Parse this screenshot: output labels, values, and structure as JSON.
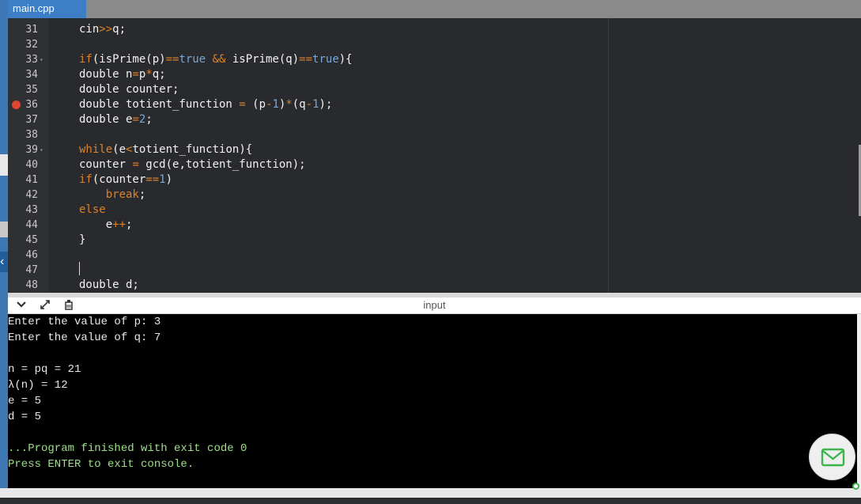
{
  "tab": {
    "filename": "main.cpp"
  },
  "editor": {
    "lines": [
      {
        "num": "31",
        "html": "cin<span class=\"op\">&gt;&gt;</span>q;"
      },
      {
        "num": "32",
        "html": ""
      },
      {
        "num": "33",
        "fold": true,
        "html": "<span class=\"kw\">if</span>(isPrime(p)<span class=\"op\">==</span><span class=\"bool\">true</span> <span class=\"op\">&amp;&amp;</span> isPrime(q)<span class=\"op\">==</span><span class=\"bool\">true</span>){"
      },
      {
        "num": "34",
        "html": "double n<span class=\"op\">=</span>p<span class=\"op\">*</span>q;"
      },
      {
        "num": "35",
        "html": "double counter;"
      },
      {
        "num": "36",
        "breakpoint": true,
        "html": "double totient_function <span class=\"op\">=</span> (p<span class=\"op\">-</span><span class=\"num\">1</span>)<span class=\"op\">*</span>(q<span class=\"op\">-</span><span class=\"num\">1</span>);"
      },
      {
        "num": "37",
        "html": "double e<span class=\"op\">=</span><span class=\"num\">2</span>;"
      },
      {
        "num": "38",
        "html": ""
      },
      {
        "num": "39",
        "fold": true,
        "html": "<span class=\"kw\">while</span>(e<span class=\"op\">&lt;</span>totient_function){"
      },
      {
        "num": "40",
        "html": "counter <span class=\"op\">=</span> gcd(e,totient_function);"
      },
      {
        "num": "41",
        "html": "<span class=\"kw\">if</span>(counter<span class=\"op\">==</span><span class=\"num\">1</span>)"
      },
      {
        "num": "42",
        "html": "    <span class=\"kw\">break</span>;"
      },
      {
        "num": "43",
        "html": "<span class=\"kw\">else</span>"
      },
      {
        "num": "44",
        "html": "    e<span class=\"op\">++</span>;"
      },
      {
        "num": "45",
        "html": "}"
      },
      {
        "num": "46",
        "html": ""
      },
      {
        "num": "47",
        "html": ""
      },
      {
        "num": "48",
        "html": "double d;"
      }
    ]
  },
  "panel": {
    "title": "input"
  },
  "console": {
    "lines": [
      {
        "text": "Enter the value of p: 3",
        "green": false
      },
      {
        "text": "Enter the value of q: 7",
        "green": false
      },
      {
        "text": "",
        "green": false
      },
      {
        "text": "n = pq = 21",
        "green": false
      },
      {
        "text": "λ(n) = 12",
        "green": false
      },
      {
        "text": "e = 5",
        "green": false
      },
      {
        "text": "d = 5",
        "green": false
      },
      {
        "text": "",
        "green": false
      },
      {
        "text": "...Program finished with exit code 0",
        "green": true
      },
      {
        "text": "Press ENTER to exit console.",
        "green": true
      }
    ]
  },
  "icons": {
    "collapse": "chevron-down-icon",
    "expand": "expand-arrows-icon",
    "clear": "clear-console-icon",
    "mail": "mail-icon"
  },
  "colors": {
    "accent": "#3c7fc7",
    "breakpoint": "#e0452f",
    "keyword": "#d9822b",
    "number": "#78a6d6",
    "console_green": "#9fe08a"
  }
}
